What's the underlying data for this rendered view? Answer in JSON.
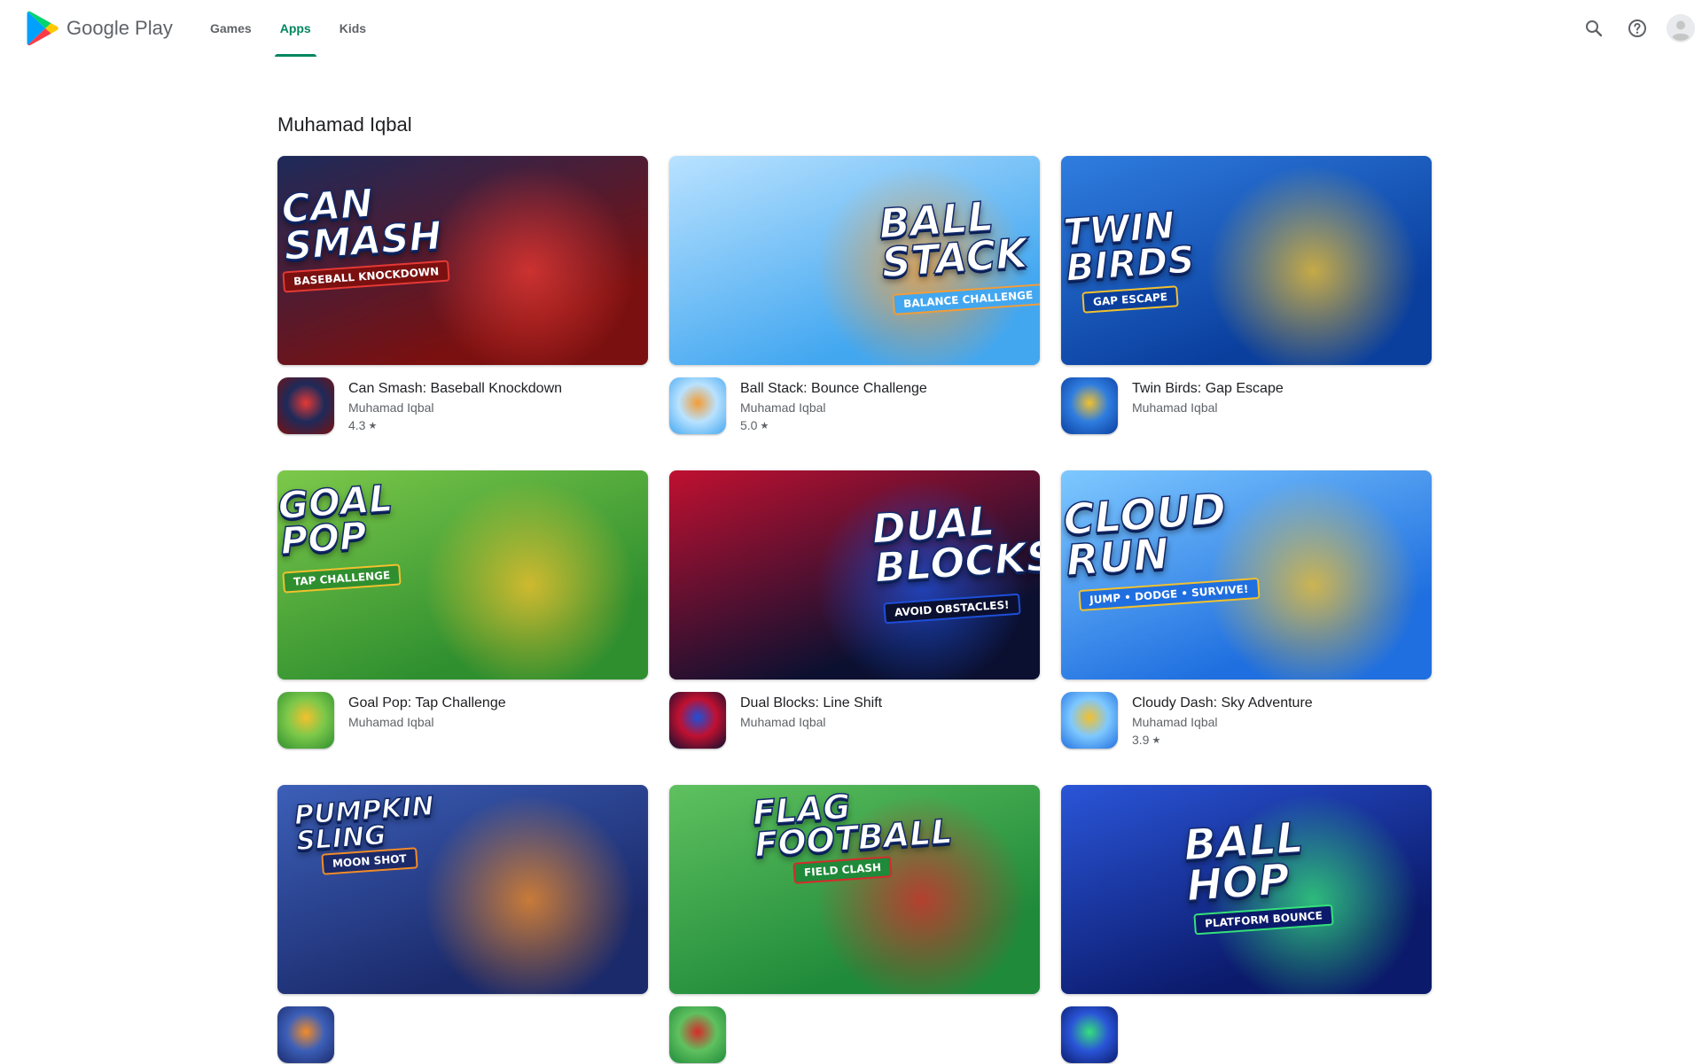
{
  "header": {
    "brand": "Google Play",
    "tabs": [
      {
        "label": "Games",
        "active": false
      },
      {
        "label": "Apps",
        "active": true
      },
      {
        "label": "Kids",
        "active": false
      }
    ],
    "icons": [
      "search-icon",
      "help-icon",
      "account-avatar-icon"
    ]
  },
  "colors": {
    "accent": "#01875f",
    "text_primary": "#202124",
    "text_secondary": "#5f6368"
  },
  "section": {
    "title": "Muhamad Iqbal"
  },
  "apps": [
    {
      "name": "Can Smash: Baseball Knockdown",
      "developer": "Muhamad Iqbal",
      "rating": "4.3",
      "banner_title": "CAN\nSMASH",
      "banner_subtitle": "BASEBALL KNOCKDOWN",
      "colors": [
        "#7a1010",
        "#1d2a5a",
        "#e53935"
      ]
    },
    {
      "name": "Ball Stack: Bounce Challenge",
      "developer": "Muhamad Iqbal",
      "rating": "5.0",
      "banner_title": "BALL\nSTACK",
      "banner_subtitle": "BALANCE CHALLENGE",
      "colors": [
        "#43a7f0",
        "#b9e2ff",
        "#f29d38"
      ]
    },
    {
      "name": "Twin Birds: Gap Escape",
      "developer": "Muhamad Iqbal",
      "rating": "",
      "banner_title": "TWIN\nBIRDS",
      "banner_subtitle": "GAP ESCAPE",
      "colors": [
        "#0a3f9e",
        "#2f7de0",
        "#f2c12e"
      ]
    },
    {
      "name": "Goal Pop: Tap Challenge",
      "developer": "Muhamad Iqbal",
      "rating": "",
      "banner_title": "GOAL\nPOP",
      "banner_subtitle": "TAP CHALLENGE",
      "colors": [
        "#2f8f2f",
        "#7cc84a",
        "#f2c12e"
      ]
    },
    {
      "name": "Dual Blocks: Line Shift",
      "developer": "Muhamad Iqbal",
      "rating": "",
      "banner_title": "DUAL\nBLOCKS",
      "banner_subtitle": "AVOID OBSTACLES!",
      "colors": [
        "#0b1030",
        "#c01030",
        "#1e4fd8"
      ]
    },
    {
      "name": "Cloudy Dash: Sky Adventure",
      "developer": "Muhamad Iqbal",
      "rating": "3.9",
      "banner_title": "CLOUD\nRUN",
      "banner_subtitle": "JUMP • DODGE • SURVIVE!",
      "colors": [
        "#1f6fe0",
        "#7ec8ff",
        "#f2c12e"
      ]
    },
    {
      "name": "",
      "developer": "",
      "rating": "",
      "banner_title": "PUMPKIN\nSLING",
      "banner_subtitle": "MOON SHOT",
      "colors": [
        "#1b2a6b",
        "#3c5fb8",
        "#f28c28"
      ]
    },
    {
      "name": "",
      "developer": "",
      "rating": "",
      "banner_title": "FLAG\nFOOTBALL",
      "banner_subtitle": "FIELD CLASH",
      "colors": [
        "#1f8a3a",
        "#5fc15f",
        "#d62b2b"
      ]
    },
    {
      "name": "",
      "developer": "",
      "rating": "",
      "banner_title": "BALL\nHOP",
      "banner_subtitle": "PLATFORM BOUNCE",
      "colors": [
        "#0b1a6b",
        "#2a55d8",
        "#35e07a"
      ]
    }
  ]
}
